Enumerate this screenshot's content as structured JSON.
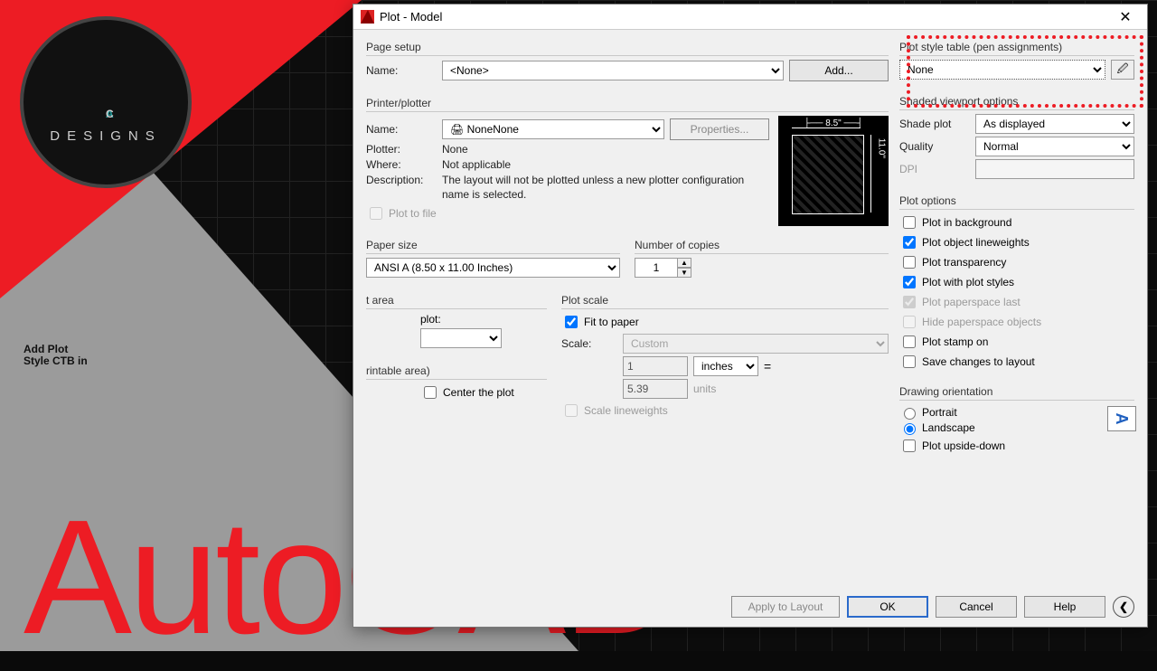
{
  "brand": {
    "logo_a": "A",
    "logo_c": "C",
    "designs": "DESIGNS"
  },
  "headline": {
    "l1": "Add Plot",
    "l2": "Style CTB in",
    "product": "AutoCAD"
  },
  "dialog": {
    "title": "Plot - Model",
    "page_setup": {
      "section": "Page setup",
      "name_label": "Name:",
      "name_value": "<None>",
      "add_btn": "Add..."
    },
    "printer": {
      "section": "Printer/plotter",
      "name_label": "Name:",
      "name_value": "None",
      "properties_btn": "Properties...",
      "plotter_label": "Plotter:",
      "plotter_value": "None",
      "where_label": "Where:",
      "where_value": "Not applicable",
      "desc_label": "Description:",
      "desc_value": "The layout will not be plotted unless a new plotter configuration name is selected.",
      "plot_to_file": "Plot to file",
      "preview": {
        "w": "8.5\"",
        "h": "11.0\""
      }
    },
    "paper": {
      "section": "Paper size",
      "value": "ANSI A (8.50 x 11.00 Inches)",
      "copies_label": "Number of copies",
      "copies_value": "1"
    },
    "area": {
      "section": "t area",
      "what_label": "plot:",
      "offset_section": "rintable area)",
      "center": "Center the plot"
    },
    "scale": {
      "section": "Plot scale",
      "fit": "Fit to paper",
      "scale_label": "Scale:",
      "scale_value": "Custom",
      "num": "1",
      "unit": "inches",
      "den": "5.39",
      "den_unit": "units",
      "lw": "Scale lineweights"
    },
    "plot_style": {
      "section": "Plot style table (pen assignments)",
      "value": "None"
    },
    "shaded": {
      "section": "Shaded viewport options",
      "shade_label": "Shade plot",
      "shade_value": "As displayed",
      "quality_label": "Quality",
      "quality_value": "Normal",
      "dpi_label": "DPI"
    },
    "options": {
      "section": "Plot options",
      "bg": "Plot in background",
      "lw": "Plot object lineweights",
      "tr": "Plot transparency",
      "ps": "Plot with plot styles",
      "pl": "Plot paperspace last",
      "hp": "Hide paperspace objects",
      "st": "Plot stamp on",
      "sv": "Save changes to layout"
    },
    "orient": {
      "section": "Drawing orientation",
      "portrait": "Portrait",
      "landscape": "Landscape",
      "upside": "Plot upside-down",
      "glyph": "A"
    },
    "footer": {
      "apply": "Apply to Layout",
      "ok": "OK",
      "cancel": "Cancel",
      "help": "Help",
      "expand": "❮"
    }
  }
}
